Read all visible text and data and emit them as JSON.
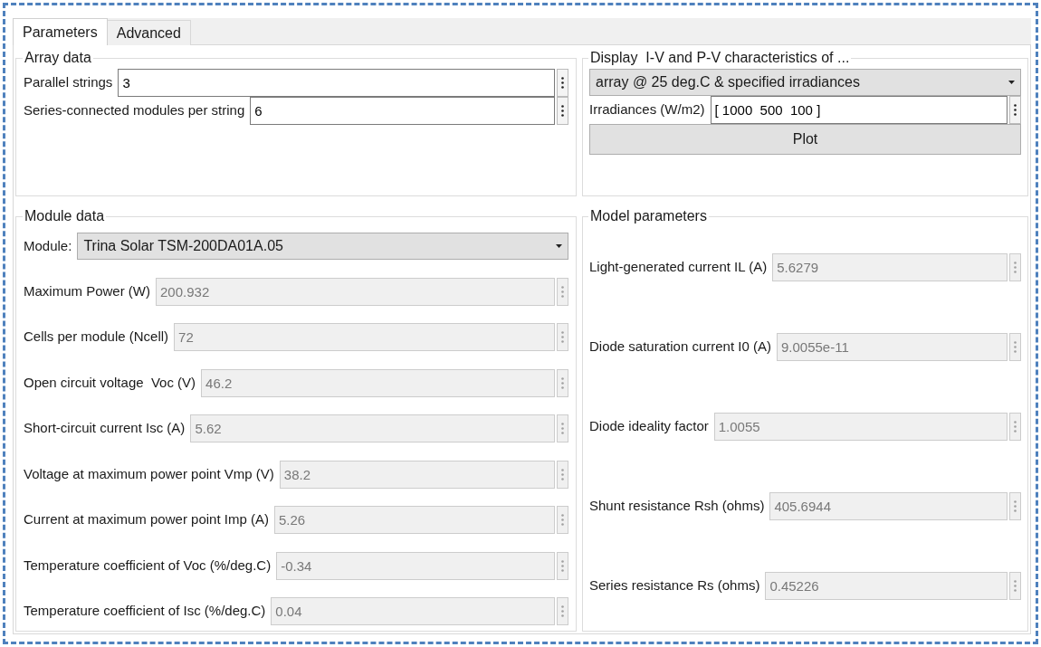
{
  "tabs": [
    {
      "label": "Parameters",
      "selected": true
    },
    {
      "label": "Advanced",
      "selected": false
    }
  ],
  "array_data": {
    "title": "Array data",
    "fields": [
      {
        "label": "Parallel strings",
        "value": "3",
        "disabled": false
      },
      {
        "label": "Series-connected modules per string",
        "value": "6",
        "disabled": false
      }
    ]
  },
  "display": {
    "title": "Display  I-V and P-V characteristics of ...",
    "dropdown": "array @ 25 deg.C & specified irradiances",
    "irradiances": {
      "label": "Irradiances (W/m2)",
      "value": "[ 1000  500  100 ]",
      "disabled": false
    },
    "plot_button": "Plot"
  },
  "module_data": {
    "title": "Module data",
    "module": {
      "label": "Module:",
      "value": "Trina Solar TSM-200DA01A.05"
    },
    "fields": [
      {
        "label": "Maximum Power (W)",
        "value": "200.932",
        "disabled": true
      },
      {
        "label": "Cells per module (Ncell)",
        "value": "72",
        "disabled": true
      },
      {
        "label": "Open circuit voltage  Voc (V)",
        "value": "46.2",
        "disabled": true
      },
      {
        "label": "Short-circuit current Isc (A)",
        "value": "5.62",
        "disabled": true
      },
      {
        "label": "Voltage at maximum power point Vmp (V)",
        "value": "38.2",
        "disabled": true
      },
      {
        "label": "Current at maximum power point Imp (A)",
        "value": "5.26",
        "disabled": true
      },
      {
        "label": "Temperature coefficient of Voc (%/deg.C)",
        "value": "-0.34",
        "disabled": true
      },
      {
        "label": "Temperature coefficient of Isc (%/deg.C)",
        "value": "0.04",
        "disabled": true
      }
    ]
  },
  "model_parameters": {
    "title": "Model parameters",
    "fields": [
      {
        "label": "Light-generated current IL (A)",
        "value": "5.6279",
        "disabled": true
      },
      {
        "label": "Diode saturation current I0 (A)",
        "value": "9.0055e-11",
        "disabled": true
      },
      {
        "label": "Diode ideality factor",
        "value": "1.0055",
        "disabled": true
      },
      {
        "label": "Shunt resistance Rsh (ohms)",
        "value": "405.6944",
        "disabled": true
      },
      {
        "label": "Series resistance Rs (ohms)",
        "value": "0.45226",
        "disabled": true
      }
    ]
  }
}
